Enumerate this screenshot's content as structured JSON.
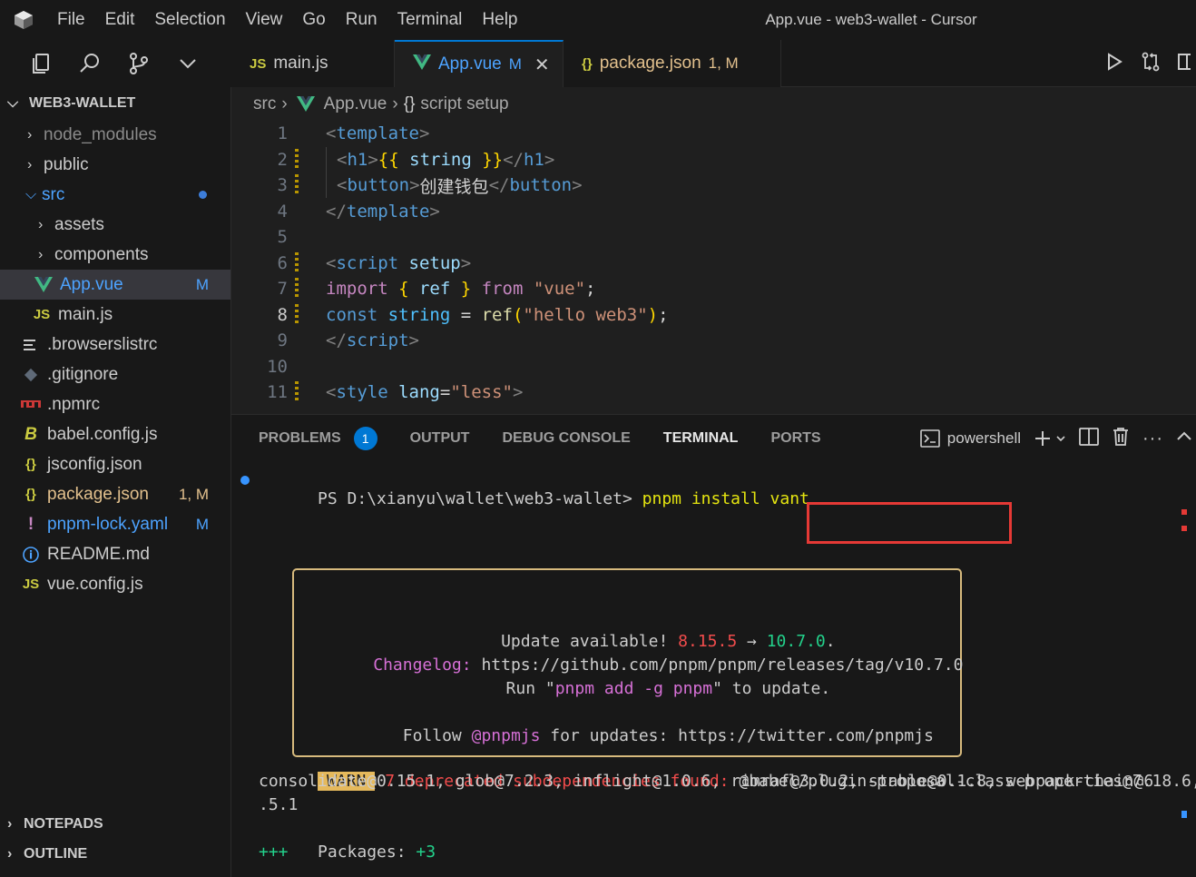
{
  "titlebar": {
    "menu": [
      "File",
      "Edit",
      "Selection",
      "View",
      "Go",
      "Run",
      "Terminal",
      "Help"
    ],
    "window_title": "App.vue - web3-wallet - Cursor"
  },
  "sidebar": {
    "section_title": "WEB3-WALLET",
    "items": [
      {
        "label": "node_modules",
        "kind": "folder"
      },
      {
        "label": "public",
        "kind": "folder"
      },
      {
        "label": "src",
        "kind": "folder-open"
      },
      {
        "label": "assets",
        "kind": "folder"
      },
      {
        "label": "components",
        "kind": "folder"
      },
      {
        "label": "App.vue",
        "badge": "M"
      },
      {
        "label": "main.js",
        "icon_text": "JS"
      },
      {
        "label": ".browserslistrc"
      },
      {
        "label": ".gitignore"
      },
      {
        "label": ".npmrc"
      },
      {
        "label": "babel.config.js"
      },
      {
        "label": "jsconfig.json",
        "icon_text": "{}"
      },
      {
        "label": "package.json",
        "badge": "1, M",
        "icon_text": "{}"
      },
      {
        "label": "pnpm-lock.yaml",
        "badge": "M",
        "icon_text": "!"
      },
      {
        "label": "README.md",
        "icon_text": "i"
      },
      {
        "label": "vue.config.js",
        "icon_text": "JS"
      }
    ],
    "notepads": "NOTEPADS",
    "outline": "OUTLINE"
  },
  "tabs": [
    {
      "label": "main.js",
      "icon_text": "JS"
    },
    {
      "label": "App.vue",
      "mod": "M",
      "active": true
    },
    {
      "label": "package.json",
      "mod": "1, M",
      "icon_text": "{}"
    }
  ],
  "breadcrumb": {
    "parts": [
      "src",
      "App.vue",
      "script setup"
    ],
    "braces": "{}"
  },
  "editor": {
    "line_numbers": [
      "1",
      "2",
      "3",
      "4",
      "5",
      "6",
      "7",
      "8",
      "9",
      "10",
      "11"
    ],
    "current_line": "8",
    "lines": {
      "l1": {
        "lt": "<",
        "tag": "template",
        "gt": ">"
      },
      "l2": {
        "lt": "<",
        "tag": "h1",
        "gt": ">",
        "open": "{{",
        "expr": " string ",
        "close": "}}",
        "lt2": "</",
        "tag2": "h1",
        "gt2": ">"
      },
      "l3": {
        "lt": "<",
        "tag": "button",
        "gt": ">",
        "text": "创建钱包",
        "lt2": "</",
        "tag2": "button",
        "gt2": ">"
      },
      "l4": {
        "lt": "</",
        "tag": "template",
        "gt": ">"
      },
      "l6": {
        "lt": "<",
        "tag": "script",
        "attr": " setup",
        "gt": ">"
      },
      "l7": {
        "kw": "import",
        "lb": " { ",
        "id": "ref",
        "rb": " } ",
        "kw2": "from",
        "str": " \"vue\"",
        "semi": ";"
      },
      "l8": {
        "kw": "const",
        "id": " string",
        "eq": " = ",
        "fn": "ref",
        "lp": "(",
        "str": "\"hello web3\"",
        "rp": ")",
        "semi": ";"
      },
      "l9": {
        "lt": "</",
        "tag": "script",
        "gt": ">"
      },
      "l11": {
        "lt": "<",
        "tag": "style",
        "attr": " lang",
        "eq": "=",
        "str": "\"less\"",
        "gt": ">"
      }
    }
  },
  "panel": {
    "tabs": [
      "PROBLEMS",
      "OUTPUT",
      "DEBUG CONSOLE",
      "TERMINAL",
      "PORTS"
    ],
    "problems_count": "1",
    "active_tab": "TERMINAL",
    "shell": "powershell"
  },
  "terminal": {
    "prompt": "PS D:\\xianyu\\wallet\\web3-wallet>",
    "command": " pnpm install vant",
    "update_box": {
      "l1_pre": "Update available! ",
      "l1_old": "8.15.5",
      "l1_arrow": " → ",
      "l1_new": "10.7.0",
      "l1_post": ".",
      "l2_label": "Changelog:",
      "l2_url": " https://github.com/pnpm/pnpm/releases/tag/v10.7.0",
      "l3_pre": "Run \"",
      "l3_cmd": "pnpm add -g pnpm",
      "l3_post": "\" to update.",
      "l4_pre": "Follow ",
      "l4_handle": "@pnpmjs",
      "l4_post": " for updates: https://twitter.com/pnpmjs"
    },
    "warn_label": "WARN",
    "warn_msg": " 7 deprecated subdependencies found:",
    "warn_deps_1": " @babel/plugin-proposal-class-properties@7.18.6,",
    "warn_deps_2": "consolidate@0.15.1, glob@7.2.3, inflight@1.0.6, rimraf@3.0.2, stable@0.1.8, webpack-chain@6",
    "warn_deps_3": ".5.1",
    "packages_label": "Packages: ",
    "packages_value": "+3",
    "progress": "+++"
  },
  "colors": {
    "accent": "#0078d4",
    "modified": "#e2c08d",
    "highlight_box": "#e53935",
    "update_border": "#d7ba7d"
  }
}
